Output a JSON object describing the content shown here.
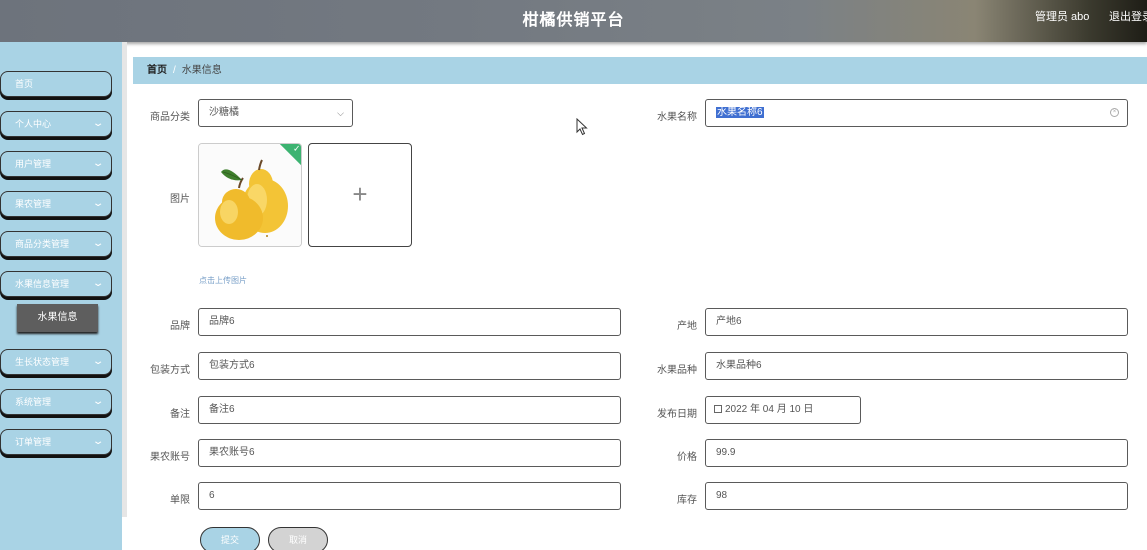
{
  "header": {
    "title": "柑橘供销平台",
    "user": "管理员 abo",
    "logout": "退出登录"
  },
  "sidebar": {
    "items": [
      {
        "label": "首页",
        "has_chevron": false
      },
      {
        "label": "个人中心",
        "has_chevron": true
      },
      {
        "label": "用户管理",
        "has_chevron": true
      },
      {
        "label": "果农管理",
        "has_chevron": true
      },
      {
        "label": "商品分类管理",
        "has_chevron": true
      },
      {
        "label": "水果信息管理",
        "has_chevron": true
      },
      {
        "label": "生长状态管理",
        "has_chevron": true
      },
      {
        "label": "系统管理",
        "has_chevron": true
      },
      {
        "label": "订单管理",
        "has_chevron": true
      }
    ],
    "active_sub": "水果信息"
  },
  "breadcrumb": {
    "home": "首页",
    "separator": "/",
    "current": "水果信息"
  },
  "form": {
    "category": {
      "label": "商品分类",
      "value": "沙糖橘"
    },
    "fruit_name": {
      "label": "水果名称",
      "value": "水果名称6"
    },
    "image": {
      "label": "图片",
      "hint": "点击上传图片"
    },
    "brand": {
      "label": "品牌",
      "value": "品牌6"
    },
    "origin": {
      "label": "产地",
      "value": "产地6"
    },
    "packaging": {
      "label": "包装方式",
      "value": "包装方式6"
    },
    "variety": {
      "label": "水果品种",
      "value": "水果品种6"
    },
    "remark": {
      "label": "备注",
      "value": "备注6"
    },
    "publish_date": {
      "label": "发布日期",
      "value": "2022 年 04 月 10 日"
    },
    "farmer_account": {
      "label": "果农账号",
      "value": "果农账号6"
    },
    "price": {
      "label": "价格",
      "value": "99.9"
    },
    "limit": {
      "label": "单限",
      "value": "6"
    },
    "stock": {
      "label": "库存",
      "value": "98"
    },
    "submit": "提交",
    "cancel": "取消"
  },
  "colors": {
    "accent": "#a9d3e5",
    "header": "#737981",
    "selection": "#3f6fd1"
  }
}
